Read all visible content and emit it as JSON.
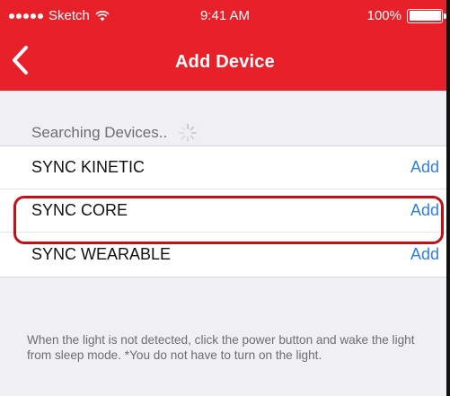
{
  "status_bar": {
    "carrier": "Sketch",
    "time": "9:41 AM",
    "battery": "100%"
  },
  "nav": {
    "title": "Add Device",
    "back_icon": "chevron-left-icon"
  },
  "searching": {
    "label": "Searching Devices.."
  },
  "devices": [
    {
      "name": "SYNC KINETIC",
      "action": "Add"
    },
    {
      "name": "SYNC CORE",
      "action": "Add"
    },
    {
      "name": "SYNC WEARABLE",
      "action": "Add"
    }
  ],
  "footnote": "When the light is not detected, click the power button and wake the light from sleep mode. *You do not have to turn on the light.",
  "colors": {
    "brand_red": "#e8202a",
    "link_blue": "#2f7fe0",
    "highlight": "#c01018"
  }
}
